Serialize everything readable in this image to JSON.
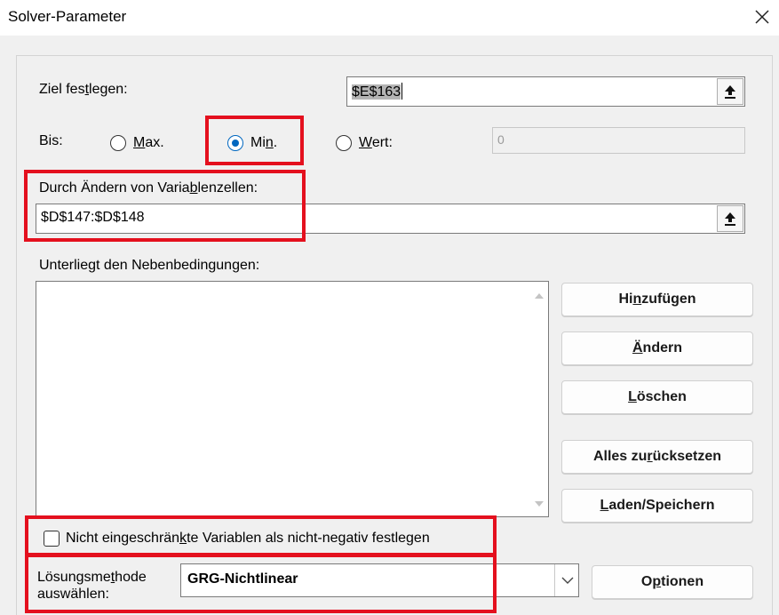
{
  "window": {
    "title": "Solver-Parameter",
    "close_icon": "close-icon"
  },
  "objective": {
    "label_pre": "Ziel fes",
    "label_u": "t",
    "label_post": "legen:",
    "value": "$E$163"
  },
  "to": {
    "label": "Bis:",
    "options": [
      {
        "pre": "",
        "u": "M",
        "post": "ax.",
        "selected": false
      },
      {
        "pre": "Mi",
        "u": "n",
        "post": ".",
        "selected": true
      },
      {
        "pre": "",
        "u": "W",
        "post": "ert:",
        "selected": false
      }
    ],
    "value_of": "0"
  },
  "variables": {
    "label_pre": "Durch Ändern von Varia",
    "label_u": "b",
    "label_post": "lenzellen:",
    "value": "$D$147:$D$148"
  },
  "constraints": {
    "label_pre": "Unterliegt den Nebenbedin",
    "label_u": "g",
    "label_post": "ungen:",
    "items": []
  },
  "buttons": {
    "add": {
      "pre": "Hi",
      "u": "n",
      "post": "zufügen"
    },
    "change": {
      "pre": "",
      "u": "Ä",
      "post": "ndern"
    },
    "delete": {
      "pre": "",
      "u": "L",
      "post": "öschen"
    },
    "reset": {
      "pre": "Alles zu",
      "u": "r",
      "post": "ücksetzen"
    },
    "load_save": {
      "pre": "",
      "u": "L",
      "post": "aden/Speichern"
    },
    "options": {
      "pre": "O",
      "u": "p",
      "post": "tionen"
    }
  },
  "nonneg": {
    "pre": "Nicht eingeschrän",
    "u": "k",
    "post": "te Variablen als nicht-negativ festlegen",
    "checked": false
  },
  "method": {
    "label_pre": "Lösungsme",
    "label_u": "t",
    "label_post": "hode",
    "label_line2": "auswählen:",
    "value": "GRG-Nichtlinear"
  },
  "colors": {
    "highlight": "#e4101e",
    "radio_selected": "#0067c0"
  }
}
